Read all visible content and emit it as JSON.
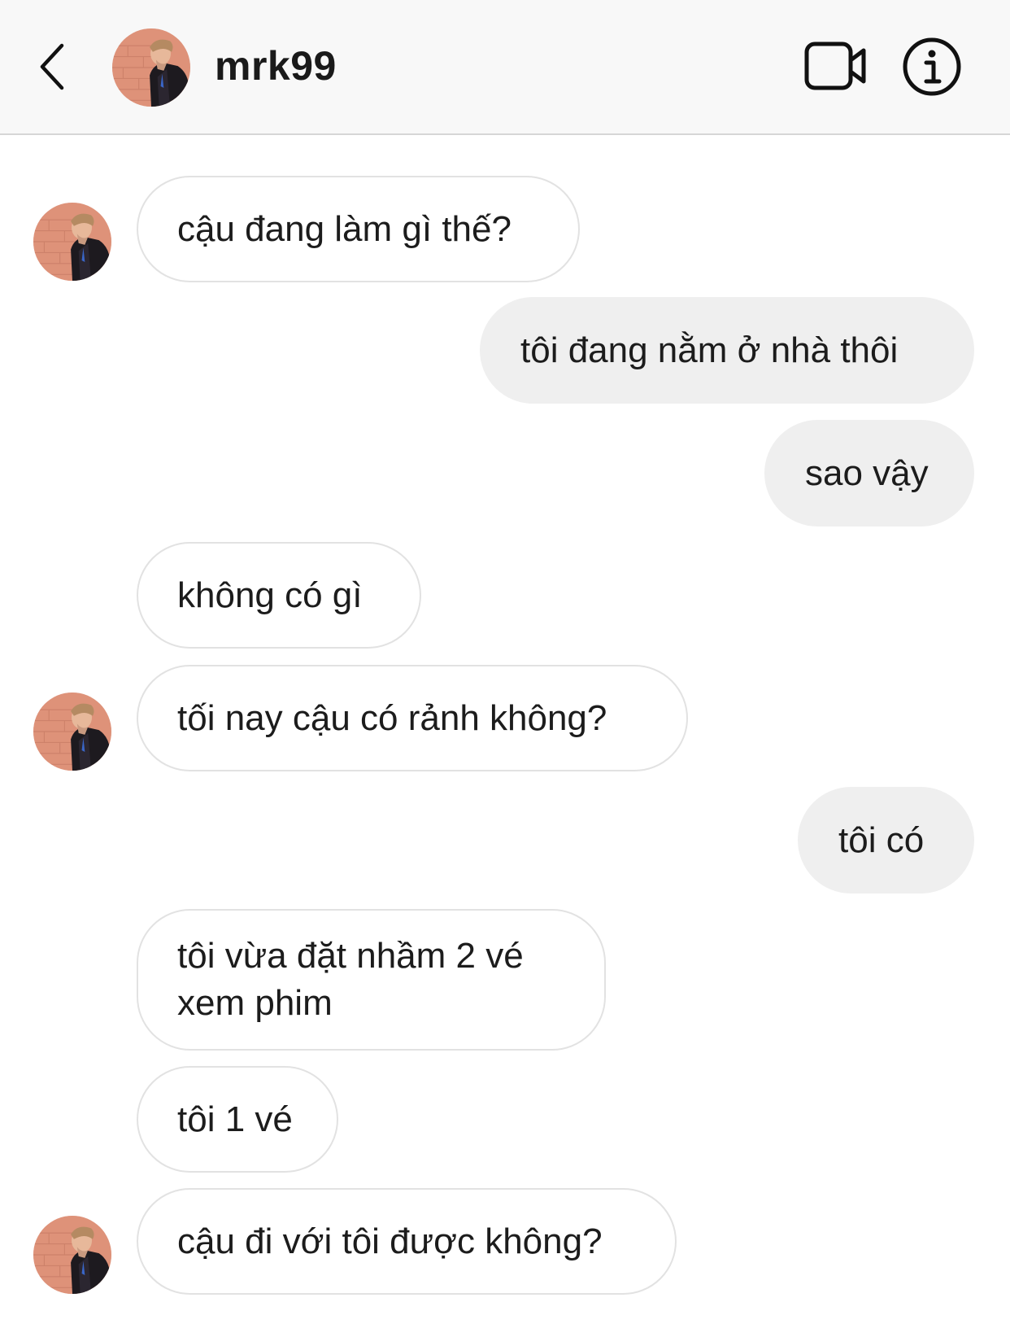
{
  "header": {
    "username": "mrk99",
    "back_icon": "chevron-left-icon",
    "video_icon": "video-camera-icon",
    "info_icon": "info-circle-icon"
  },
  "colors": {
    "header_bg": "#f8f8f8",
    "incoming_bubble_border": "#e2e2e2",
    "outgoing_bubble_bg": "#efefef"
  },
  "messages": [
    {
      "sender": "them",
      "text": "cậu đang làm gì thế?"
    },
    {
      "sender": "me",
      "text": "tôi đang nằm ở nhà thôi"
    },
    {
      "sender": "me",
      "text": "sao vậy"
    },
    {
      "sender": "them",
      "text": "không có gì"
    },
    {
      "sender": "them",
      "text": "tối nay cậu có rảnh không?"
    },
    {
      "sender": "me",
      "text": "tôi có"
    },
    {
      "sender": "them",
      "text": "tôi vừa đặt nhầm 2 vé xem phim"
    },
    {
      "sender": "them",
      "text": "tôi 1 vé"
    },
    {
      "sender": "them",
      "text": "cậu đi với tôi được không?"
    }
  ]
}
